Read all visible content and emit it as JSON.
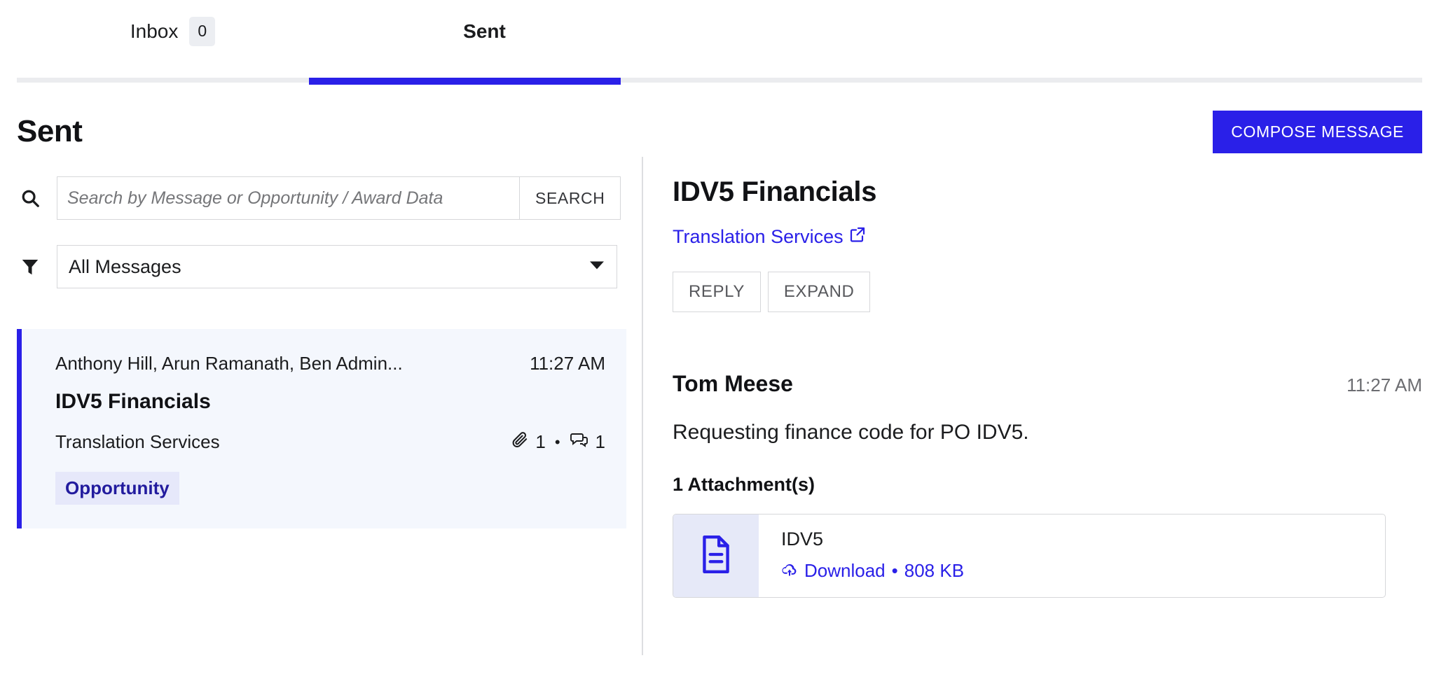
{
  "theme": {
    "accent": "#2A20E8",
    "selected_row_bg": "#F4F7FD",
    "tag_bg": "#E6E8FA",
    "tag_text": "#221B9E",
    "track": "#EBECEF"
  },
  "tabs": [
    {
      "label": "Inbox",
      "badge": "0",
      "active": false,
      "icon": "inbox-tab"
    },
    {
      "label": "Sent",
      "badge": "",
      "active": true,
      "icon": "sent-tab"
    }
  ],
  "header": {
    "title": "Sent",
    "compose_label": "COMPOSE MESSAGE"
  },
  "search": {
    "icon": "search-icon",
    "placeholder": "Search by Message or Opportunity / Award Data",
    "value": "",
    "button_label": "SEARCH"
  },
  "filter": {
    "icon": "filter-icon",
    "selected": "All Messages",
    "caret_icon": "chevron-down-icon",
    "options": [
      "All Messages"
    ]
  },
  "message_list": [
    {
      "recipients": "Anthony Hill, Arun Ramanath, Ben Admin...",
      "time": "11:27 AM",
      "subject": "IDV5 Financials",
      "context": "Translation Services",
      "attachment_icon": "paperclip-icon",
      "attachment_count": "1",
      "separator": "•",
      "comment_icon": "comments-icon",
      "comment_count": "1",
      "tag": "Opportunity",
      "selected": true
    }
  ],
  "thread": {
    "title": "IDV5 Financials",
    "link_label": "Translation Services",
    "link_icon": "external-link-icon",
    "actions": [
      {
        "label": "REPLY",
        "name": "reply-button"
      },
      {
        "label": "EXPAND",
        "name": "expand-button"
      }
    ],
    "message": {
      "sender": "Tom Meese",
      "time": "11:27 AM",
      "body": "Requesting finance code for PO IDV5.",
      "attachments_heading": "1 Attachment(s)",
      "attachments": [
        {
          "file_icon": "document-icon",
          "name": "IDV5",
          "download_icon": "cloud-download-icon",
          "download_label": "Download",
          "separator": "•",
          "size": "808 KB"
        }
      ]
    }
  }
}
